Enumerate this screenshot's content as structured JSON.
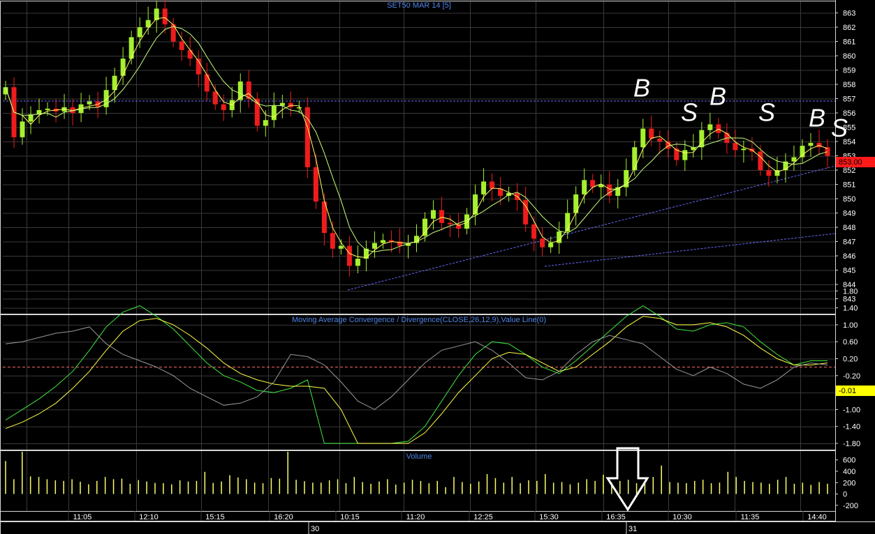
{
  "colors": {
    "background": "#000000",
    "grid": "#3a3a3a",
    "panel_border": "#d8d8d8",
    "up_candle": "#a6f02e",
    "down_candle": "#ee1c1c",
    "ma_fast": "#ffff66",
    "ma_slow": "#c8ff7a",
    "trend_dotted": "#6a6aff",
    "axis_text": "#ffffff",
    "title_text": "#4f86e8",
    "macd_line": "#3fe83f",
    "signal_line": "#ffff44",
    "third_line": "#9a9a9a",
    "zero_line": "#ff6b6b",
    "volume_bar": "#ffff66",
    "price_tag_bg": "#ff1a1a",
    "macd_tag_bg": "#ffff00"
  },
  "price_panel": {
    "title": "SET50 MAR 14   [5]",
    "price_tag": "853.00",
    "ticks": [
      "863",
      "862",
      "861",
      "860",
      "859",
      "858",
      "857",
      "856",
      "855",
      "854",
      "853",
      "852",
      "851",
      "850",
      "849",
      "848",
      "847",
      "846",
      "845",
      "844",
      "843"
    ],
    "markers": [
      {
        "text": "B",
        "price": 857.2
      },
      {
        "text": "S",
        "price": 855.5
      },
      {
        "text": "B",
        "price": 856.6
      },
      {
        "text": "S",
        "price": 855.5
      },
      {
        "text": "B",
        "price": 855.1
      },
      {
        "text": "S",
        "price": 854.4
      }
    ]
  },
  "macd_panel": {
    "title": "Moving Average Convergence / Divergence(CLOSE,26,12,9),Value Line(0)",
    "ticks": [
      "1.80",
      "1.40",
      "1.00",
      "0.60",
      "0.20",
      "-0.20",
      "-0.60",
      "-1.00",
      "-1.40",
      "-1.80"
    ],
    "value_tag": "-0.01"
  },
  "volume_panel": {
    "title": "Volume",
    "ticks": [
      "600",
      "400",
      "200",
      "0",
      "-200"
    ],
    "arrow_icon": "down-arrow-icon"
  },
  "time_axis": {
    "labels": [
      "11:05",
      "12:10",
      "15:15",
      "16:20",
      "10:15",
      "11:20",
      "12:25",
      "15:30",
      "16:35",
      "10:30",
      "11:35",
      "14:40"
    ],
    "day_labels": [
      "30",
      "31"
    ]
  },
  "chart_data": [
    {
      "type": "candlestick",
      "title": "SET50 MAR 14   [5]",
      "ylim": [
        843,
        863
      ],
      "grid": true,
      "series": [
        {
          "name": "close",
          "values": [
            857.8,
            854.3,
            855.4,
            855.9,
            856.2,
            856.3,
            856.1,
            856.4,
            856.0,
            856.6,
            856.8,
            856.4,
            857.6,
            858.6,
            859.8,
            861.3,
            862.0,
            862.5,
            863.3,
            862.2,
            861.0,
            860.4,
            859.8,
            858.7,
            857.5,
            856.6,
            856.2,
            856.9,
            858.2,
            857.0,
            855.1,
            855.5,
            856.5,
            856.7,
            856.4,
            856.4,
            852.2,
            849.8,
            847.6,
            846.5,
            846.7,
            845.3,
            845.8,
            846.5,
            846.9,
            847.1,
            847.0,
            846.7,
            846.9,
            847.4,
            848.6,
            849.2,
            848.3,
            848.2,
            847.9,
            848.9,
            850.3,
            851.2,
            850.7,
            850.2,
            850.4,
            849.9,
            848.2,
            847.2,
            846.6,
            846.9,
            847.7,
            849.0,
            850.3,
            851.3,
            850.8,
            851.0,
            850.2,
            850.8,
            852.0,
            853.6,
            854.9,
            854.2,
            854.0,
            853.5,
            852.7,
            853.4,
            853.6,
            854.8,
            855.2,
            854.6,
            853.9,
            853.4,
            853.5,
            853.3,
            852.0,
            851.6,
            852.0,
            852.6,
            852.9,
            853.7,
            853.9,
            853.6,
            853.0
          ]
        }
      ]
    },
    {
      "type": "line",
      "title": "Moving Average Convergence / Divergence(CLOSE,26,12,9),Value Line(0)",
      "ylim": [
        -1.8,
        1.8
      ],
      "series": [
        {
          "values": [
            -1.25,
            -1.0,
            -0.75,
            -0.45,
            -0.1,
            0.4,
            0.95,
            1.3,
            1.45,
            1.2,
            0.9,
            0.5,
            0.1,
            -0.2,
            -0.35,
            -0.55,
            -0.6,
            -0.5,
            -0.3,
            -1.8,
            -1.8,
            -1.8,
            -1.8,
            -1.8,
            -1.75,
            -1.4,
            -0.8,
            -0.2,
            0.3,
            0.6,
            0.55,
            0.3,
            0.0,
            -0.15,
            0.15,
            0.5,
            0.85,
            1.2,
            1.45,
            1.2,
            0.9,
            0.85,
            1.0,
            1.05,
            0.95,
            0.6,
            0.3,
            0.05,
            0.15,
            0.15
          ]
        },
        {
          "values": [
            -1.45,
            -1.3,
            -1.1,
            -0.85,
            -0.5,
            -0.1,
            0.4,
            0.85,
            1.1,
            1.15,
            1.0,
            0.75,
            0.45,
            0.1,
            -0.15,
            -0.3,
            -0.4,
            -0.45,
            -0.45,
            -0.5,
            -1.0,
            -1.8,
            -1.8,
            -1.8,
            -1.8,
            -1.55,
            -1.1,
            -0.6,
            -0.2,
            0.2,
            0.35,
            0.3,
            0.1,
            -0.1,
            0.0,
            0.3,
            0.6,
            0.95,
            1.2,
            1.15,
            1.0,
            1.0,
            1.05,
            0.95,
            0.75,
            0.45,
            0.2,
            0.05,
            0.05,
            0.1
          ]
        },
        {
          "values": [
            0.55,
            0.6,
            0.7,
            0.8,
            0.85,
            0.95,
            0.55,
            0.3,
            0.15,
            0.0,
            -0.2,
            -0.5,
            -0.7,
            -0.9,
            -0.85,
            -0.7,
            -0.35,
            0.3,
            0.25,
            0.05,
            -0.35,
            -0.8,
            -1.0,
            -0.7,
            -0.3,
            0.1,
            0.4,
            0.5,
            0.6,
            0.4,
            0.1,
            -0.25,
            -0.3,
            -0.1,
            0.3,
            0.6,
            0.75,
            0.65,
            0.55,
            0.25,
            -0.05,
            -0.2,
            0.0,
            -0.15,
            -0.4,
            -0.5,
            -0.3,
            0.0,
            0.1,
            0.05
          ]
        }
      ]
    },
    {
      "type": "bar",
      "title": "Volume",
      "ylim": [
        -200,
        600
      ],
      "values": [
        580,
        260,
        800,
        310,
        300,
        260,
        240,
        230,
        260,
        215,
        170,
        230,
        300,
        260,
        270,
        180,
        245,
        220,
        195,
        190,
        170,
        240,
        220,
        230,
        390,
        195,
        220,
        330,
        290,
        260,
        200,
        190,
        280,
        270,
        810,
        250,
        225,
        200,
        200,
        240,
        260,
        190,
        300,
        210,
        180,
        220,
        260,
        165,
        200,
        250,
        230,
        190,
        230,
        120,
        300,
        210,
        180,
        220,
        350,
        280,
        200,
        300,
        190,
        240,
        230,
        350,
        200,
        210,
        170,
        200,
        260,
        230,
        340,
        200,
        230,
        250,
        190,
        210,
        300,
        500,
        210,
        200,
        190,
        230,
        250,
        190,
        200,
        390,
        300,
        230,
        210,
        200,
        180,
        250,
        300,
        180,
        200,
        160,
        210,
        180
      ]
    }
  ]
}
